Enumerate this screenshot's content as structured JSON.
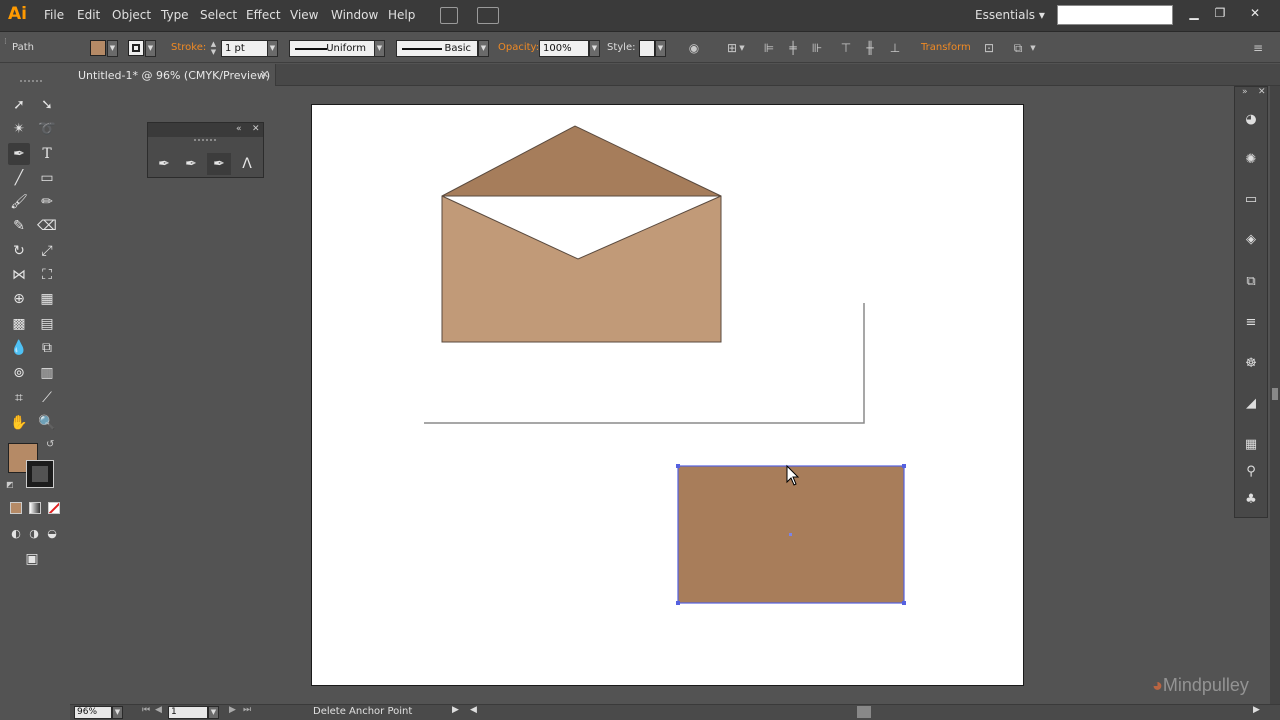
{
  "app": {
    "logo": "Ai",
    "workspace": "Essentials"
  },
  "menu": [
    "File",
    "Edit",
    "Object",
    "Type",
    "Select",
    "Effect",
    "View",
    "Window",
    "Help"
  ],
  "window_controls": {
    "minimize": "▁",
    "restore": "❐",
    "close": "✕"
  },
  "control_bar": {
    "selection_type": "Path",
    "stroke_label": "Stroke:",
    "stroke_weight": "1 pt",
    "variable_width": "Uniform",
    "brush_definition": "Basic",
    "opacity_label": "Opacity:",
    "opacity_value": "100%",
    "style_label": "Style:",
    "transform_label": "Transform"
  },
  "document_tab": {
    "title": "Untitled-1* @ 96% (CMYK/Preview)",
    "close": "✕"
  },
  "colors": {
    "fill": "#b58a66",
    "envelope_flap": "#a67d5b",
    "envelope_body": "#c19a78",
    "rectangle": "#a87d5a",
    "selection": "#5561e0"
  },
  "status_bar": {
    "zoom": "96%",
    "artboard_number": "1",
    "current_tool": "Delete Anchor Point"
  },
  "watermark": "Mindpulley"
}
